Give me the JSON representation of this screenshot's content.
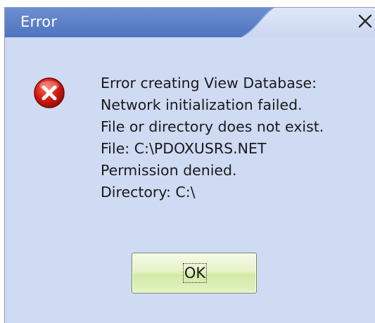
{
  "window": {
    "title": "Error",
    "close_symbol": "×"
  },
  "message": {
    "lines": [
      "Error creating View Database:",
      "Network initialization failed.",
      "File or directory does not exist.",
      "File: C:\\PDOXUSRS.NET",
      "Permission denied.",
      "Directory: C:\\"
    ]
  },
  "buttons": {
    "ok_label": "OK"
  },
  "icons": {
    "error": "error-icon",
    "close": "close-icon"
  },
  "colors": {
    "title_bar": "#5b80c8",
    "window_body": "#cfdaf3",
    "error_red": "#c8140e",
    "ok_button": "#dff0b8"
  }
}
